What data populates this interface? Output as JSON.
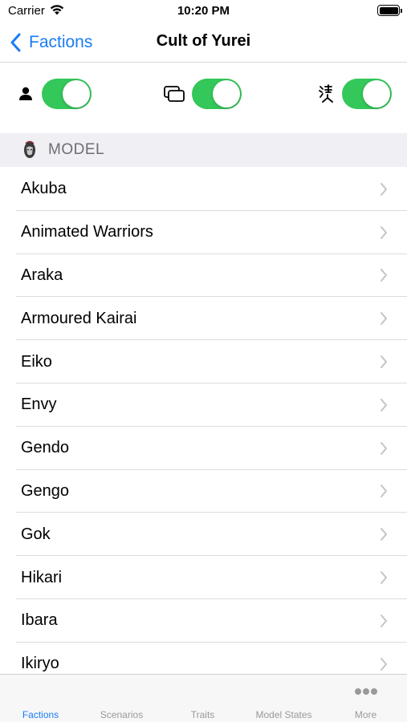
{
  "status_bar": {
    "carrier": "Carrier",
    "time": "10:20 PM"
  },
  "nav": {
    "back_label": "Factions",
    "title": "Cult of Yurei"
  },
  "toggles": [
    {
      "icon": "person-icon",
      "on": true
    },
    {
      "icon": "cards-icon",
      "on": true
    },
    {
      "icon": "kanji-icon",
      "on": true
    }
  ],
  "section": {
    "icon": "model-portrait-icon",
    "title": "MODEL"
  },
  "models": [
    "Akuba",
    "Animated Warriors",
    "Araka",
    "Armoured Kairai",
    "Eiko",
    "Envy",
    "Gendo",
    "Gengo",
    "Gok",
    "Hikari",
    "Ibara",
    "Ikiryo"
  ],
  "tabs": [
    {
      "label": "Factions",
      "active": true
    },
    {
      "label": "Scenarios",
      "active": false
    },
    {
      "label": "Traits",
      "active": false
    },
    {
      "label": "Model States",
      "active": false
    },
    {
      "label": "More",
      "active": false,
      "icon": "more-icon"
    }
  ],
  "colors": {
    "accent": "#1a7cf5",
    "switch_on": "#34c759",
    "section_bg": "#efeff4"
  }
}
